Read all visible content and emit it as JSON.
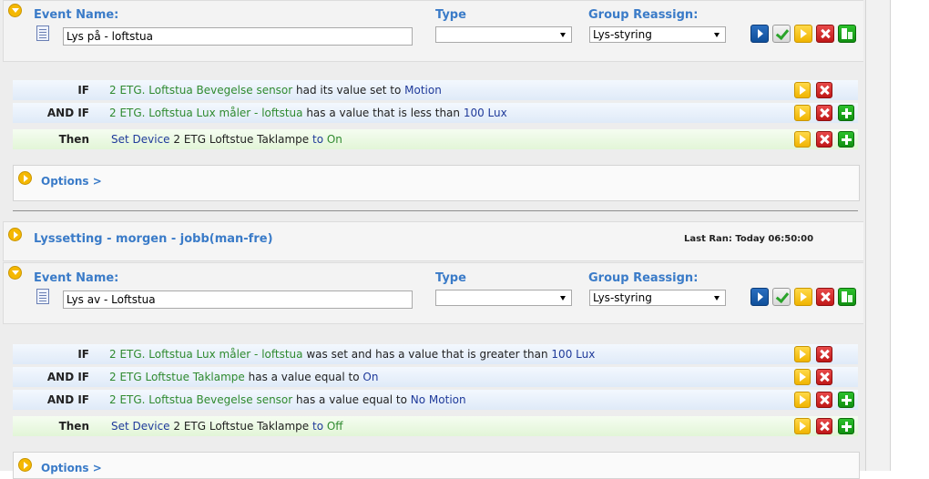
{
  "labels": {
    "event_name": "Event Name:",
    "type": "Type",
    "group_reassign": "Group Reassign:",
    "options": "Options >"
  },
  "event1": {
    "name_value": "Lys på - loftstua",
    "type_value": "",
    "group_value": "Lys-styring",
    "conditions": [
      {
        "kw": "IF",
        "parts": [
          {
            "t": "2 ETG. Loftstua Bevegelse sensor",
            "c": "g"
          },
          {
            "t": " had its value set to ",
            "c": "d"
          },
          {
            "t": "Motion",
            "c": "b"
          }
        ]
      },
      {
        "kw": "AND IF",
        "parts": [
          {
            "t": "2 ETG. Loftstua Lux måler - loftstua",
            "c": "g"
          },
          {
            "t": " has a value that is less than ",
            "c": "d"
          },
          {
            "t": "100 Lux",
            "c": "b"
          }
        ]
      }
    ],
    "then": {
      "kw": "Then",
      "parts": [
        {
          "t": "Set Device ",
          "c": "b"
        },
        {
          "t": "2 ETG Loftstue Taklampe",
          "c": "d"
        },
        {
          "t": " to ",
          "c": "b"
        },
        {
          "t": "On",
          "c": "g"
        }
      ]
    }
  },
  "section2": {
    "title": "Lyssetting - morgen - jobb(man-fre)",
    "last_ran": "Last Ran: Today 06:50:00"
  },
  "event2": {
    "name_value": "Lys av - Loftstua",
    "type_value": "",
    "group_value": "Lys-styring",
    "conditions": [
      {
        "kw": "IF",
        "parts": [
          {
            "t": "2 ETG. Loftstua Lux måler - loftstua",
            "c": "g"
          },
          {
            "t": " was set and has a value that is greater than ",
            "c": "d"
          },
          {
            "t": "100 Lux",
            "c": "b"
          }
        ]
      },
      {
        "kw": "AND IF",
        "parts": [
          {
            "t": "2 ETG Loftstue Taklampe",
            "c": "g"
          },
          {
            "t": " has a value equal to ",
            "c": "d"
          },
          {
            "t": "On",
            "c": "b"
          }
        ]
      },
      {
        "kw": "AND IF",
        "parts": [
          {
            "t": "2 ETG. Loftstua Bevegelse sensor",
            "c": "g"
          },
          {
            "t": " has a value equal to ",
            "c": "d"
          },
          {
            "t": "No Motion",
            "c": "b"
          }
        ]
      }
    ],
    "then": {
      "kw": "Then",
      "parts": [
        {
          "t": "Set Device ",
          "c": "b"
        },
        {
          "t": "2 ETG Loftstue Taklampe",
          "c": "d"
        },
        {
          "t": " to ",
          "c": "b"
        },
        {
          "t": "Off",
          "c": "g"
        }
      ]
    }
  },
  "colors": {
    "link_blue": "#3a7bc8",
    "device_green": "#2f8a2f",
    "value_blue": "#1f3a9a"
  }
}
